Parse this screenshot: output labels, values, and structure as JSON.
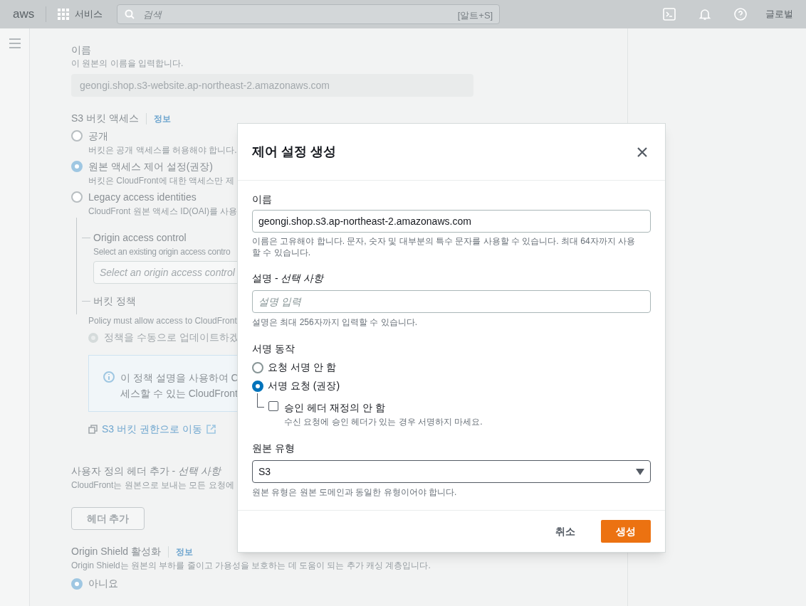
{
  "top_nav": {
    "logo": "aws",
    "services": "서비스",
    "search_placeholder": "검색",
    "search_shortcut": "[알트+S]",
    "region": "글로벌"
  },
  "background": {
    "name_label": "이름",
    "name_hint": "이 원본의 이름을 입력합니다.",
    "name_value": "geongi.shop.s3-website.ap-northeast-2.amazonaws.com",
    "access_label": "S3 버킷 액세스",
    "access_info": "정보",
    "access_options": [
      {
        "label": "공개",
        "desc": "버킷은 공개 액세스를 허용해야 합니다.",
        "selected": false
      },
      {
        "label": "원본 액세스 제어 설정(권장)",
        "desc": "버킷은 CloudFront에 대한 액세스만 제",
        "selected": true
      },
      {
        "label": "Legacy access identities",
        "desc": "CloudFront 원본 액세스 ID(OAI)를 사용",
        "selected": false
      }
    ],
    "oac_label": "Origin access control",
    "oac_hint": "Select an existing origin access contro",
    "oac_placeholder": "Select an origin access control",
    "policy_label": "버킷 정책",
    "policy_hint": "Policy must allow access to CloudFront",
    "policy_option": {
      "label": "정책을 수동으로 업데이트하겠",
      "selected": true,
      "disabled": true
    },
    "info_lines": [
      "이 정책 설명을 사용하여 C",
      "세스할 수 있는 CloudFront"
    ],
    "bucket_link": "S3 버킷 권한으로 이동",
    "headers_label": "사용자 정의 헤더 추가 - *선택 사항*",
    "headers_hint": "CloudFront는 원본으로 보내는 모든 요청에",
    "add_header": "헤더 추가",
    "shield_label": "Origin Shield 활성화",
    "shield_info": "정보",
    "shield_hint": "Origin Shield는 원본의 부하를 줄이고 가용성을 보호하는 데 도움이 되는 추가 캐싱 계층입니다.",
    "shield_options": [
      {
        "label": "아니요",
        "selected": true
      }
    ]
  },
  "modal": {
    "title": "제어 설정 생성",
    "name_label": "이름",
    "name_value": "geongi.shop.s3.ap-northeast-2.amazonaws.com",
    "name_hint": "이름은 고유해야 합니다. 문자, 숫자 및 대부분의 특수 문자를 사용할 수 있습니다. 최대 64자까지 사용할 수 있습니다.",
    "desc_label": "설명 - *선택 사항*",
    "desc_placeholder": "설명 입력",
    "desc_hint": "설명은 최대 256자까지 입력할 수 있습니다.",
    "sign_label": "서명 동작",
    "sign_options": [
      {
        "label": "요청 서명 안 함",
        "selected": false
      },
      {
        "label": "서명 요청 (권장)",
        "selected": true
      }
    ],
    "override": {
      "label": "승인 헤더 재정의 안 함",
      "desc": "수신 요청에 승인 헤더가 있는 경우 서명하지 마세요.",
      "checked": false
    },
    "origin_type_label": "원본 유형",
    "origin_type_value": "S3",
    "origin_type_hint": "원본 유형은 원본 도메인과 동일한 유형이어야 합니다.",
    "cancel": "취소",
    "create": "생성"
  }
}
